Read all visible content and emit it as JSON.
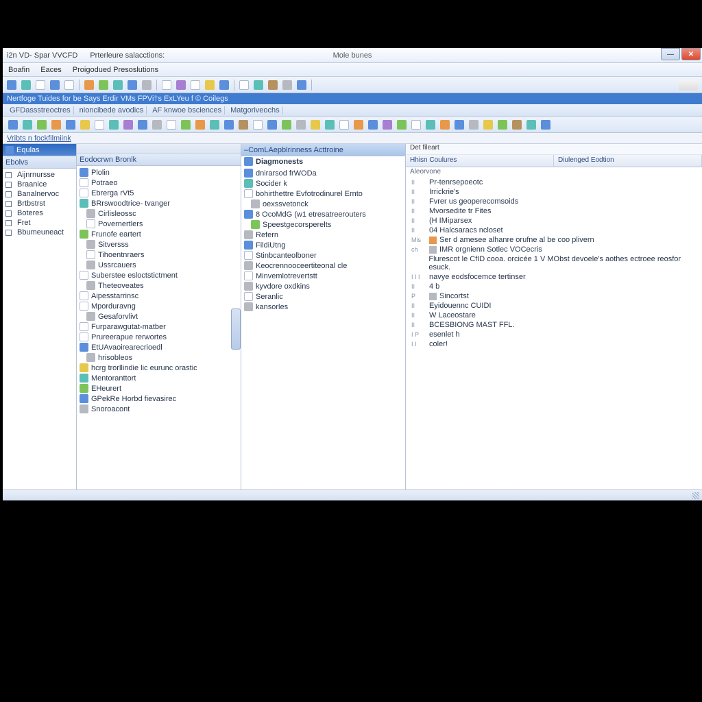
{
  "title_bar": {
    "left": "i2n VD- Spar VVCFD",
    "left2": "Prterleure salacctions:",
    "center": "Mole bunes"
  },
  "menu": [
    "Boafin",
    "Eaces",
    "Proigodued Presoslutions"
  ],
  "sub_bar": "Nertfoge Tuides for be Says Erdir VMs FPVi†s ExLYeu f © Coilegs",
  "breadcrumbs": [
    "GFDassstreoctres",
    "nioncibede avodics",
    "AF knwoe bsciences",
    "Matgoriveochs"
  ],
  "label_bar": "Vribts n fockfilmiink",
  "pane1": {
    "selected": "Equlas",
    "header2": "Ebolvs",
    "items": [
      "Aijnrnursse",
      "Braanice",
      "Banalnervoc",
      "Brtbstrst",
      "Boteres",
      "Fret",
      "Bbumeuneact"
    ]
  },
  "pane2": {
    "header": "Eodocrwn Bronlk",
    "items": [
      {
        "t": "Plolin",
        "c": "c-blue"
      },
      {
        "t": "Potraeo",
        "c": "c-white"
      },
      {
        "t": "Ebrerga rVt5",
        "c": "c-white"
      },
      {
        "t": "BRrswoodtrice- tvanger",
        "c": "c-teal"
      },
      {
        "t": "Cirlisleossc",
        "c": "c-gray",
        "i": 1
      },
      {
        "t": "Povernertlers",
        "c": "c-white",
        "i": 1
      },
      {
        "t": "Frunofe eartert",
        "c": "c-green"
      },
      {
        "t": "Sitversss",
        "c": "c-gray",
        "i": 1
      },
      {
        "t": "Tihoentnraers",
        "c": "c-white",
        "i": 1
      },
      {
        "t": "Ussrcauers",
        "c": "c-gray",
        "i": 1
      },
      {
        "t": "Suberstee esloctstictment",
        "c": "c-white"
      },
      {
        "t": "Theteoveates",
        "c": "c-gray",
        "i": 1
      },
      {
        "t": "Aipesstarrinsc",
        "c": "c-white"
      },
      {
        "t": "Mporduravng",
        "c": "c-white"
      },
      {
        "t": "Gesaforvlivt",
        "c": "c-gray",
        "i": 1
      },
      {
        "t": "Furparawgutat-matber",
        "c": "c-white"
      },
      {
        "t": "Prureerapue rerwortes",
        "c": "c-white"
      },
      {
        "t": "EtUAvaoirearecrioedl",
        "c": "c-blue"
      },
      {
        "t": "hrisobleos",
        "c": "c-gray",
        "i": 1
      },
      {
        "t": "hcrg trorllindie lic eurunc orastic",
        "c": "c-yellow"
      },
      {
        "t": "Mentoranttort",
        "c": "c-teal"
      },
      {
        "t": "EHeurert",
        "c": "c-green"
      },
      {
        "t": "GPekRe Horbd fievasirec",
        "c": "c-blue"
      },
      {
        "t": "Snoroacont",
        "c": "c-gray"
      }
    ]
  },
  "pane3": {
    "header": "–ComLAepblrinness Acttroine",
    "sub": "Diagmonests",
    "items": [
      {
        "t": "dnirarsod frWODa",
        "c": "c-blue"
      },
      {
        "t": "Socider k",
        "c": "c-teal"
      },
      {
        "t": "bohirthettre Evfotrodinurel Ernto",
        "c": "c-white"
      },
      {
        "t": "oexssvetonck",
        "c": "c-gray",
        "i": 1
      },
      {
        "t": "8 OcoMdG (w1 etresatreerouters",
        "c": "c-blue"
      },
      {
        "t": "Speestgecorsperelts",
        "c": "c-green",
        "i": 1
      },
      {
        "t": "Refern",
        "c": "c-gray"
      },
      {
        "t": "FildiUtng",
        "c": "c-blue"
      },
      {
        "t": "Stinbcanteolboner",
        "c": "c-white"
      },
      {
        "t": "Keocrennooceertiteonal cle",
        "c": "c-gray"
      },
      {
        "t": "Minvemlotrevertstt",
        "c": "c-white"
      },
      {
        "t": "kyvdore oxdkins",
        "c": "c-gray"
      },
      {
        "t": "Seranlic",
        "c": "c-white"
      },
      {
        "t": "kansorles",
        "c": "c-gray"
      }
    ]
  },
  "pane4": {
    "title": "Det fileart",
    "col1": "Hhisn Coulures",
    "col2": "Diulenged Eodtion",
    "sub": "Aleorvone",
    "items": [
      {
        "p": "II",
        "t": "Pr-tenrsepoeotc"
      },
      {
        "p": "II",
        "t": "Irrickrie's"
      },
      {
        "p": "II",
        "t": "Fvrer   us geoperecomsoids"
      },
      {
        "p": "II",
        "t": "Mvorsedite tr Fites"
      },
      {
        "p": "II",
        "t": "(H   IMiparsex"
      },
      {
        "p": "II",
        "t": "04   Halcsaracs ncloset"
      },
      {
        "p": "Mis",
        "t": "Ser d amesee alhanre orufne al be coo plivern",
        "c": "c-orange"
      },
      {
        "p": "ch",
        "t": "IMR orgnienn Sotlec VOCecris",
        "c": "c-gray"
      },
      {
        "p": "",
        "t": "Flurescot le CfID cooa. orcicée      1    V MObst    devoele's aothes ectroee reosfor esuck."
      },
      {
        "p": "I I I",
        "t": "navye eodsfocemce tertinser"
      },
      {
        "p": "II",
        "t": "4 b"
      },
      {
        "p": "P",
        "t": "Sincortst",
        "c": "c-gray"
      },
      {
        "p": "II",
        "t": "Eyidouennc CUIDI"
      },
      {
        "p": "II",
        "t": "W  Laceostare"
      },
      {
        "p": "II",
        "t": "BCESBIONG MAST FFL."
      },
      {
        "p": "I P",
        "t": "esenlet h"
      },
      {
        "p": "I I",
        "t": "coler!"
      }
    ]
  },
  "toolbar1_icons": [
    "c-blue",
    "c-teal",
    "c-white",
    "c-blue",
    "c-white",
    "c-orange",
    "c-green",
    "c-teal",
    "c-blue",
    "c-gray",
    "c-white",
    "c-purple",
    "c-white",
    "c-yellow",
    "c-blue",
    "c-white",
    "c-teal",
    "c-brown",
    "c-gray",
    "c-blue"
  ],
  "toolbar2_icons": [
    "c-blue",
    "c-teal",
    "c-green",
    "c-orange",
    "c-blue",
    "c-yellow",
    "c-white",
    "c-teal",
    "c-purple",
    "c-blue",
    "c-gray",
    "c-white",
    "c-green",
    "c-orange",
    "c-teal",
    "c-blue",
    "c-brown",
    "c-white",
    "c-blue",
    "c-green",
    "c-gray",
    "c-yellow",
    "c-teal",
    "c-white",
    "c-orange",
    "c-blue",
    "c-purple",
    "c-green",
    "c-white",
    "c-teal",
    "c-orange",
    "c-blue",
    "c-gray",
    "c-yellow",
    "c-green",
    "c-brown",
    "c-teal",
    "c-blue"
  ]
}
